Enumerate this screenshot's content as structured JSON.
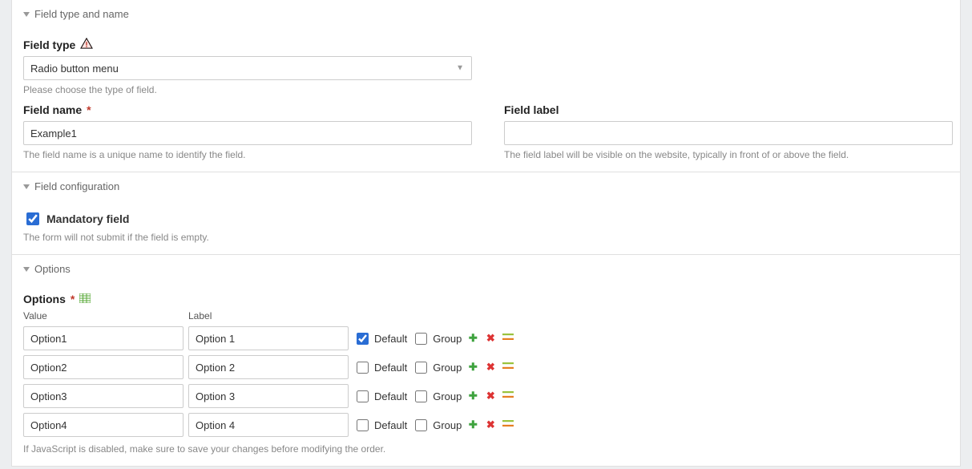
{
  "sections": {
    "typeAndName": {
      "title": "Field type and name"
    },
    "config": {
      "title": "Field configuration"
    },
    "options": {
      "title": "Options"
    }
  },
  "fieldType": {
    "label": "Field type",
    "value": "Radio button menu",
    "help": "Please choose the type of field."
  },
  "fieldName": {
    "label": "Field name",
    "value": "Example1",
    "help": "The field name is a unique name to identify the field."
  },
  "fieldLabel": {
    "label": "Field label",
    "value": "",
    "help": "The field label will be visible on the website, typically in front of or above the field."
  },
  "mandatory": {
    "label": "Mandatory field",
    "checked": true,
    "help": "The form will not submit if the field is empty."
  },
  "optionsBlock": {
    "label": "Options",
    "headers": {
      "value": "Value",
      "label": "Label"
    },
    "defaultLabel": "Default",
    "groupLabel": "Group",
    "rows": [
      {
        "value": "Option1",
        "label": "Option 1",
        "default": true,
        "group": false
      },
      {
        "value": "Option2",
        "label": "Option 2",
        "default": false,
        "group": false
      },
      {
        "value": "Option3",
        "label": "Option 3",
        "default": false,
        "group": false
      },
      {
        "value": "Option4",
        "label": "Option 4",
        "default": false,
        "group": false
      }
    ],
    "help": "If JavaScript is disabled, make sure to save your changes before modifying the order."
  }
}
